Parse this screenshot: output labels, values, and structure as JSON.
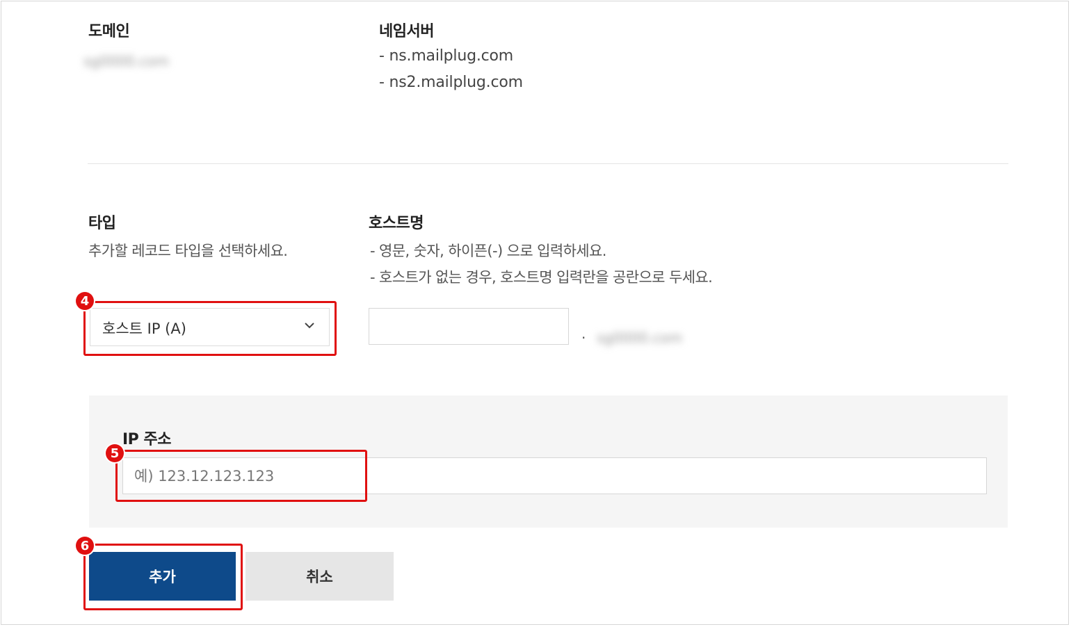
{
  "domain_section": {
    "heading": "도메인",
    "value": "sg0000.com"
  },
  "nameserver_section": {
    "heading": "네임서버",
    "items": [
      "- ns.mailplug.com",
      "- ns2.mailplug.com"
    ]
  },
  "type_section": {
    "heading": "타입",
    "description": "추가할 레코드 타입을 선택하세요.",
    "selected": "호스트 IP (A)"
  },
  "host_section": {
    "heading": "호스트명",
    "notes": [
      "- 영문, 숫자, 하이픈(-) 으로 입력하세요.",
      "- 호스트가 없는 경우, 호스트명 입력란을 공란으로 두세요."
    ],
    "separator": ".",
    "domain_suffix": "sg0000.com",
    "value": ""
  },
  "ip_section": {
    "label": "IP 주소",
    "placeholder": "예) 123.12.123.123",
    "value": ""
  },
  "buttons": {
    "add": "추가",
    "cancel": "취소"
  },
  "annotations": {
    "step4": "4",
    "step5": "5",
    "step6": "6",
    "color": "#e01010"
  },
  "colors": {
    "primary_button": "#0e4a8a",
    "secondary_button": "#e6e6e6",
    "panel_background": "#f5f5f5"
  },
  "icons": {
    "select_arrow": "chevron-down-icon"
  }
}
